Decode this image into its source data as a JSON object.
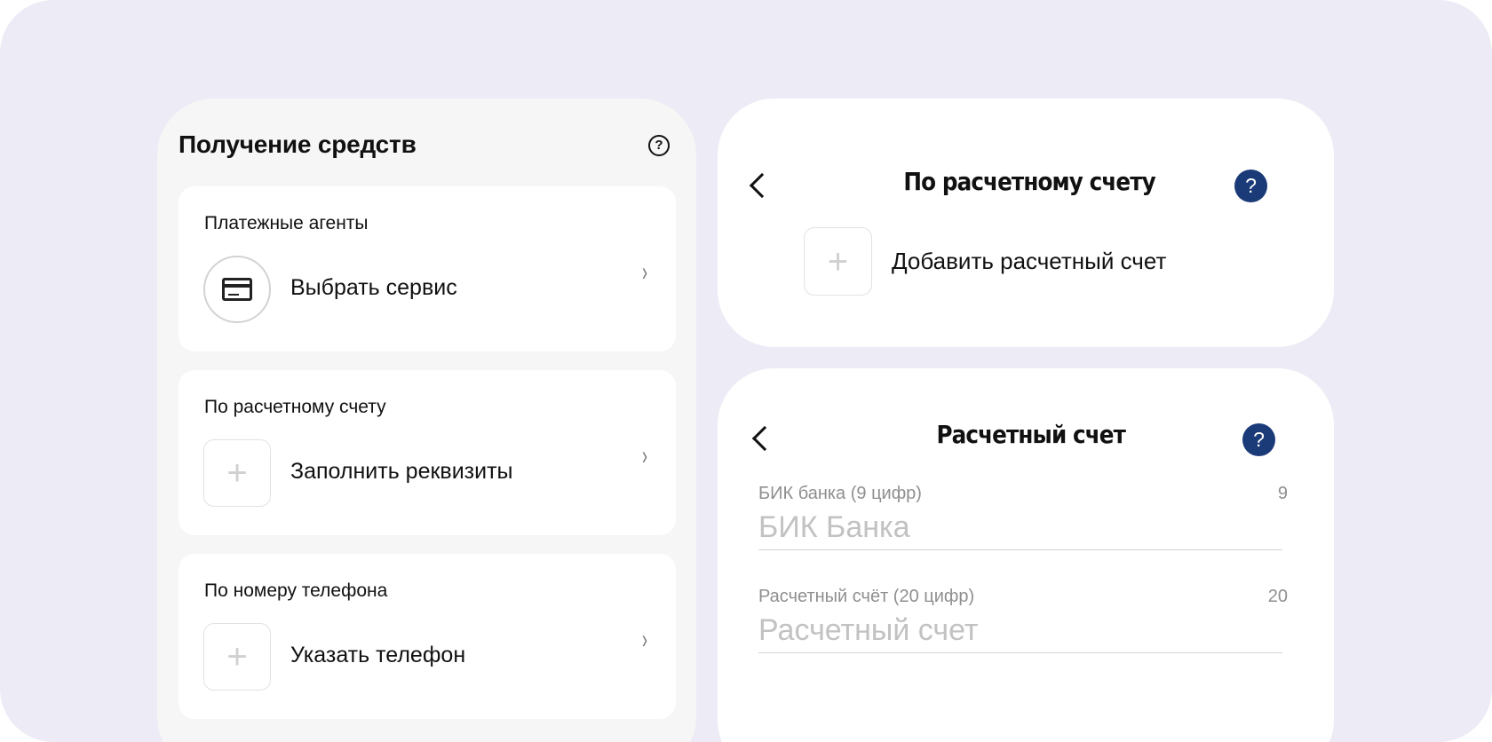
{
  "left": {
    "title": "Получение средств",
    "help_glyph": "?",
    "cards": [
      {
        "heading": "Платежные агенты",
        "action": "Выбрать сервис",
        "icon": "credit-card-icon"
      },
      {
        "heading": "По расчетному счету",
        "action": "Заполнить реквизиты",
        "icon": "plus-icon"
      },
      {
        "heading": "По номеру телефона",
        "action": "Указать телефон",
        "icon": "plus-icon"
      }
    ],
    "plus_glyph": "+",
    "chevron_glyph": "›"
  },
  "account_panel": {
    "title": "По расчетному счету",
    "help_glyph": "?",
    "add_glyph": "+",
    "add_label": "Добавить расчетный счет"
  },
  "form_panel": {
    "title": "Расчетный счет",
    "help_glyph": "?",
    "fields": [
      {
        "label": "БИК банка (9 цифр)",
        "count": "9",
        "placeholder": "БИК Банка"
      },
      {
        "label": "Расчетный счёт (20 цифр)",
        "count": "20",
        "placeholder": "Расчетный счет"
      }
    ]
  },
  "colors": {
    "background": "#edecf6",
    "help_button": "#1b3a78",
    "muted_text": "#8f8f8f"
  }
}
